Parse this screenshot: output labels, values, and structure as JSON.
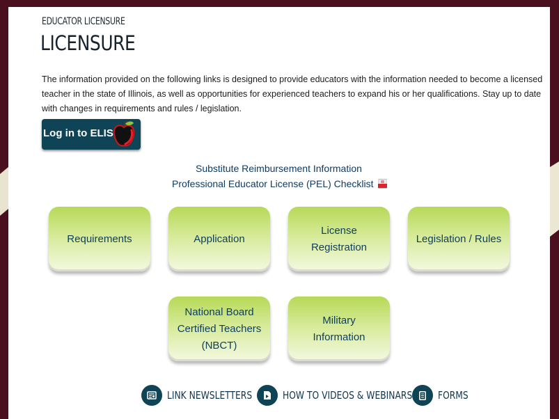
{
  "header": {
    "eyebrow": "EDUCATOR LICENSURE",
    "title": "LICENSURE"
  },
  "intro": {
    "text": "The information provided on the following links is designed to provide educators with the information needed to become a licensed teacher in the state of Illinois, as well as opportunities for experienced teachers to expand his or her qualifications. Stay up to date with changes in requirements and rules / legislation."
  },
  "elis_button": {
    "label": "Log in to ELIS",
    "icon": "apple-icon",
    "colors": {
      "background": "#0f4457",
      "text": "#ffffff"
    }
  },
  "links": {
    "substitute": "Substitute Reimbursement Information",
    "pel_checklist": "Professional Educator License (PEL) Checklist",
    "pel_icon": "pdf-icon"
  },
  "tiles": {
    "requirements": "Requirements",
    "application": "Application",
    "license_registration_line1": "License",
    "license_registration_line2": "Registration",
    "legislation": "Legislation / Rules",
    "nbct_line1": "National Board",
    "nbct_line2": "Certified Teachers",
    "nbct_line3": "(NBCT)",
    "military_line1": "Military",
    "military_line2": "Information"
  },
  "bottom_links": {
    "newsletters": "LINK NEWSLETTERS",
    "newsletters_icon": "newsletter-icon",
    "videos": "HOW TO VIDEOS & WEBINARS",
    "videos_icon": "video-icon",
    "forms": "FORMS",
    "forms_icon": "document-icon"
  },
  "colors": {
    "frame": "#4a1020",
    "accent_dark": "#0f4457",
    "link": "#0f3b63",
    "tile_top": "#b6d957",
    "tile_bottom": "#f4f9e2"
  }
}
